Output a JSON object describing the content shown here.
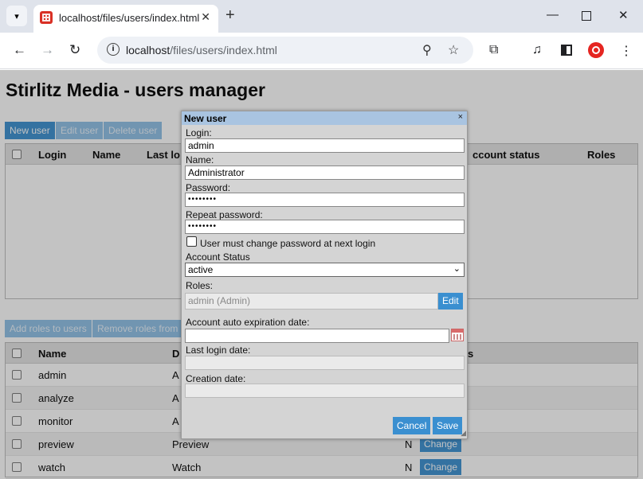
{
  "browser": {
    "tab_title": "localhost/files/users/index.html",
    "url_host": "localhost",
    "url_path": "/files/users/index.html"
  },
  "page": {
    "title": "Stirlitz Media - users manager",
    "toolbar": {
      "new_user": "New user",
      "edit_user": "Edit user",
      "delete_user": "Delete user"
    },
    "users_grid": {
      "columns": [
        "Login",
        "Name",
        "Last lo",
        "ccount status",
        "Roles"
      ]
    },
    "roles_toolbar": {
      "add_roles": "Add roles to users",
      "remove_roles": "Remove roles from"
    },
    "roles_grid": {
      "columns": [
        "Name",
        "D",
        "s"
      ],
      "rows": [
        {
          "name": "admin",
          "desc": "A",
          "flag": "",
          "action": ""
        },
        {
          "name": "analyze",
          "desc": "A",
          "flag": "",
          "action": ""
        },
        {
          "name": "monitor",
          "desc": "A",
          "flag": "",
          "action": ""
        },
        {
          "name": "preview",
          "desc": "Preview",
          "flag": "N",
          "action": "Change"
        },
        {
          "name": "watch",
          "desc": "Watch",
          "flag": "N",
          "action": "Change"
        }
      ]
    }
  },
  "dialog": {
    "title": "New user",
    "close": "×",
    "login_label": "Login:",
    "login_value": "admin",
    "name_label": "Name:",
    "name_value": "Administrator",
    "password_label": "Password:",
    "password_value": "••••••••",
    "repeat_label": "Repeat password:",
    "repeat_value": "••••••••",
    "must_change_label": "User must change password at next login",
    "status_label": "Account Status",
    "status_value": "active",
    "roles_label": "Roles:",
    "roles_value": "admin (Admin)",
    "edit_label": "Edit",
    "expiration_label": "Account auto expiration date:",
    "last_login_label": "Last login date:",
    "creation_label": "Creation date:",
    "cancel_label": "Cancel",
    "save_label": "Save"
  }
}
